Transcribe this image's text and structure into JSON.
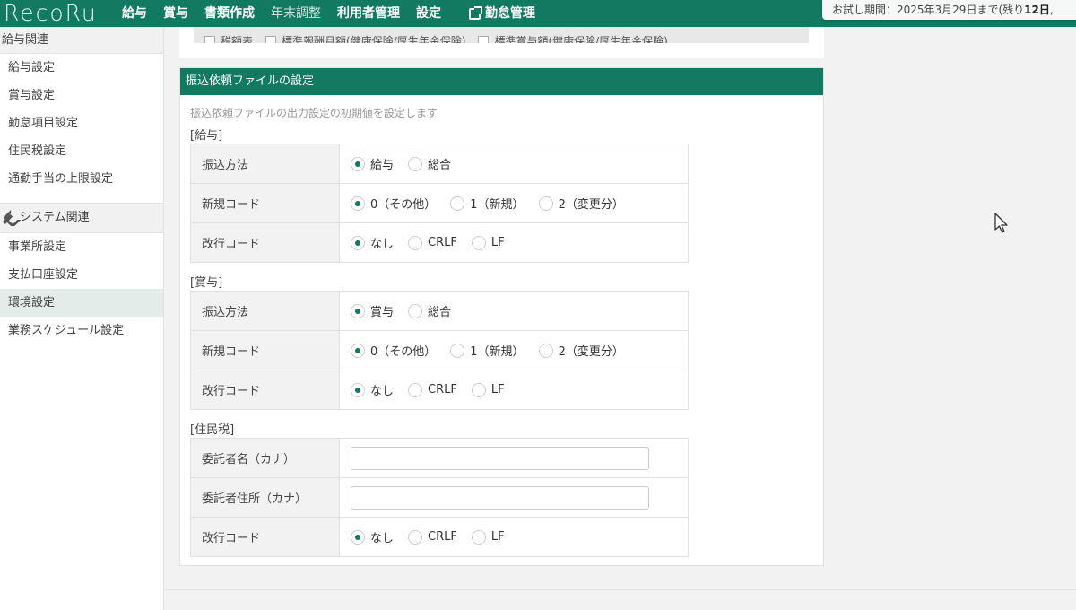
{
  "app": {
    "logo": "RecoRu"
  },
  "nav": {
    "items": [
      {
        "label": "給与",
        "dim": false
      },
      {
        "label": "賞与",
        "dim": false
      },
      {
        "label": "書類作成",
        "dim": false
      },
      {
        "label": "年末調整",
        "dim": true
      },
      {
        "label": "利用者管理",
        "dim": false
      },
      {
        "label": "設定",
        "dim": false
      }
    ],
    "external": {
      "label": "勤怠管理",
      "icon": "external-link-icon"
    }
  },
  "trial": {
    "prefix": "お試し期間：2025年3月29日まで(残り",
    "days": "12日",
    "suffix": ","
  },
  "sidebar": {
    "salary_head": "給与関連",
    "salary_items": [
      "給与設定",
      "賞与設定",
      "勤怠項目設定",
      "住民税設定",
      "通勤手当の上限設定"
    ],
    "system_head": "システム関連",
    "system_icon": "wrench-icon",
    "system_items": [
      {
        "label": "事業所設定",
        "active": false
      },
      {
        "label": "支払口座設定",
        "active": false
      },
      {
        "label": "環境設定",
        "active": true
      },
      {
        "label": "業務スケジュール設定",
        "active": false
      }
    ]
  },
  "top_card": {
    "checkboxes": [
      "税額表",
      "標準報酬月額(健康保険/厚生年金保険)",
      "標準賞与額(健康保険/厚生年金保険)"
    ]
  },
  "card": {
    "title": "振込依頼ファイルの設定",
    "description": "振込依頼ファイルの出力設定の初期値を設定します",
    "sections": {
      "salary": {
        "label": "[給与]",
        "rows": {
          "method": {
            "label": "振込方法",
            "options": [
              "給与",
              "総合"
            ],
            "selected": 0
          },
          "new_code": {
            "label": "新規コード",
            "options": [
              "0（その他）",
              "1（新規）",
              "2（変更分）"
            ],
            "selected": 0
          },
          "newline": {
            "label": "改行コード",
            "options": [
              "なし",
              "CRLF",
              "LF"
            ],
            "selected": 0
          }
        }
      },
      "bonus": {
        "label": "[賞与]",
        "rows": {
          "method": {
            "label": "振込方法",
            "options": [
              "賞与",
              "総合"
            ],
            "selected": 0
          },
          "new_code": {
            "label": "新規コード",
            "options": [
              "0（その他）",
              "1（新規）",
              "2（変更分）"
            ],
            "selected": 0
          },
          "newline": {
            "label": "改行コード",
            "options": [
              "なし",
              "CRLF",
              "LF"
            ],
            "selected": 0
          }
        }
      },
      "resident_tax": {
        "label": "[住民税]",
        "rows": {
          "consignor_name": {
            "label": "委託者名（カナ）",
            "value": ""
          },
          "consignor_address": {
            "label": "委託者住所（カナ）",
            "value": ""
          },
          "newline": {
            "label": "改行コード",
            "options": [
              "なし",
              "CRLF",
              "LF"
            ],
            "selected": 0
          }
        }
      }
    }
  },
  "colors": {
    "brand": "#137a62",
    "active_sidebar": "#e3ece8"
  }
}
